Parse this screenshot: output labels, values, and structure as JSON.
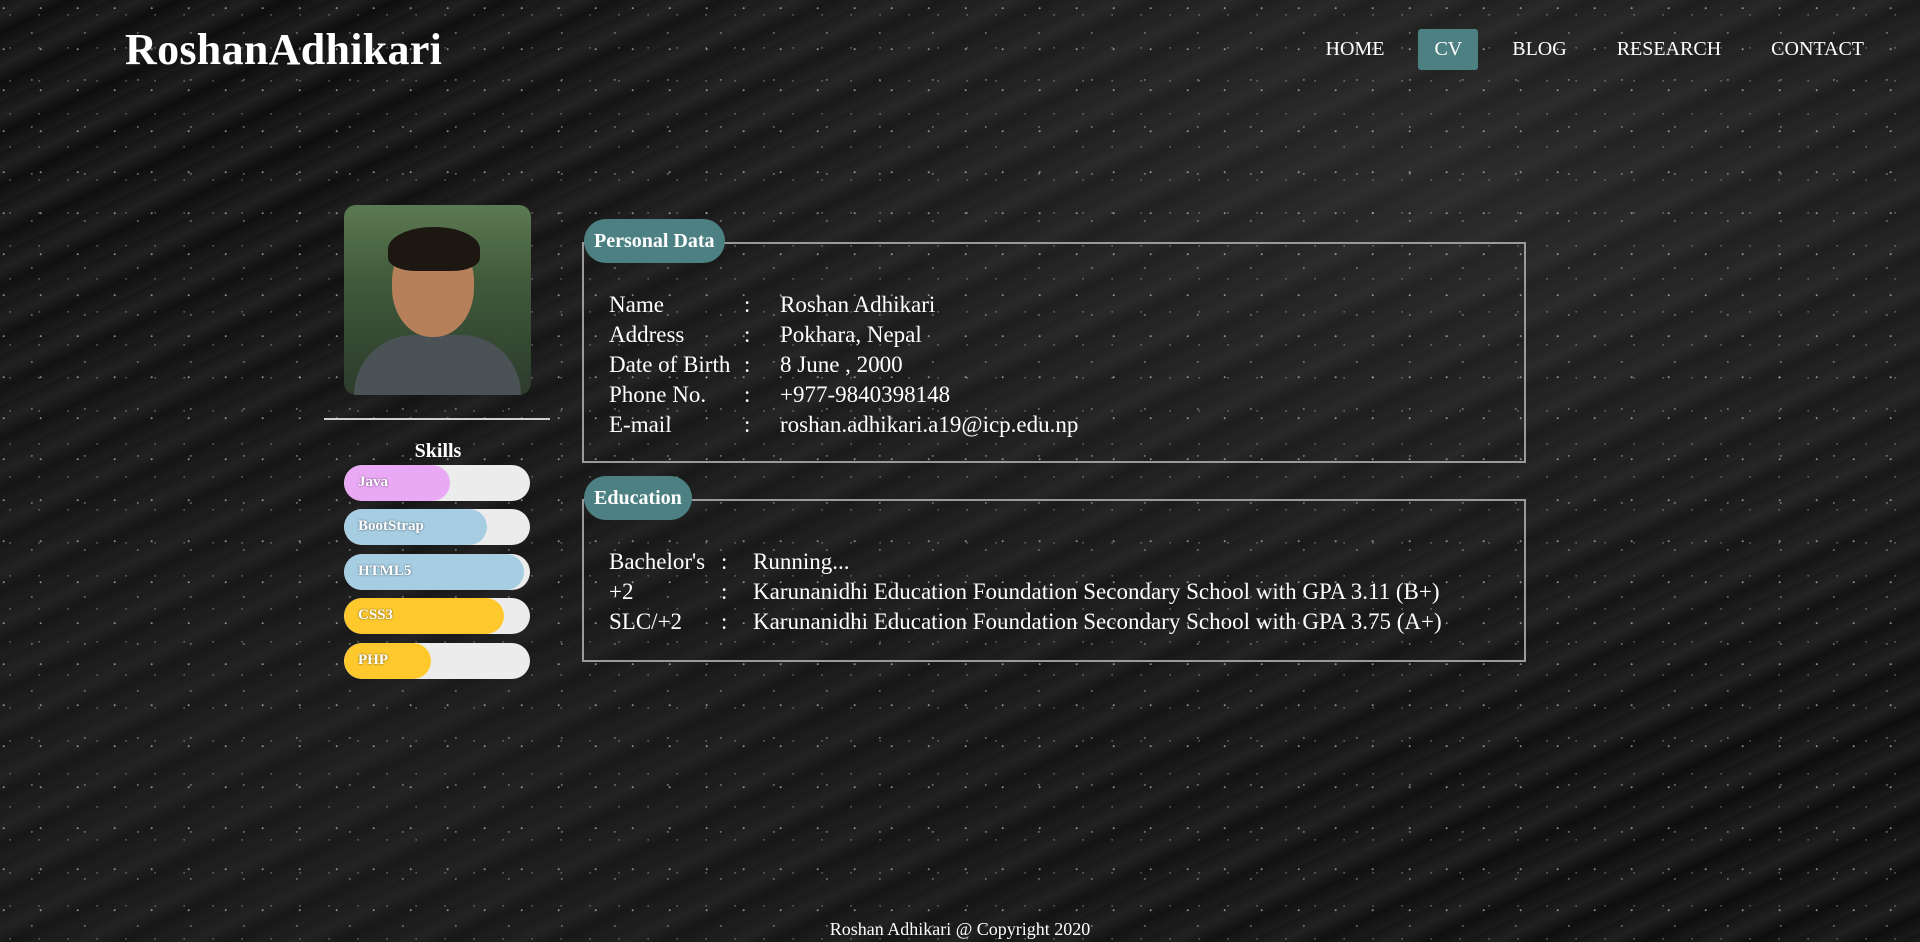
{
  "brand": "RoshanAdhikari",
  "nav": [
    "HOME",
    "CV",
    "BLOG",
    "RESEARCH",
    "CONTACT"
  ],
  "nav_active": "CV",
  "skills": {
    "title": "Skills",
    "items": [
      {
        "name": "Java",
        "level": 0.57,
        "color": "#e9a9f5"
      },
      {
        "name": "BootStrap",
        "level": 0.77,
        "color": "#a6cde2"
      },
      {
        "name": "HTML5",
        "level": 0.97,
        "color": "#a6cde2"
      },
      {
        "name": "CSS3",
        "level": 0.86,
        "color": "#ffc92e"
      },
      {
        "name": "PHP",
        "level": 0.47,
        "color": "#ffc92e"
      }
    ]
  },
  "personal": {
    "title": "Personal Data",
    "rows": [
      {
        "key": "Name",
        "sep": ":",
        "value": "Roshan Adhikari"
      },
      {
        "key": "Address",
        "sep": ":",
        "value": "Pokhara, Nepal"
      },
      {
        "key": "Date of Birth",
        "sep": ":",
        "value": "8 June , 2000"
      },
      {
        "key": "Phone No.",
        "sep": ":",
        "value": "+977-9840398148"
      },
      {
        "key": "E-mail",
        "sep": ":",
        "value": "roshan.adhikari.a19@icp.edu.np"
      }
    ]
  },
  "education": {
    "title": "Education",
    "rows": [
      {
        "key": "Bachelor's",
        "sep": ":",
        "value": "Running..."
      },
      {
        "key": "+2",
        "sep": ":",
        "value": "Karunanidhi Education Foundation Secondary School with GPA 3.11 (B+)"
      },
      {
        "key": "SLC/+2",
        "sep": ":",
        "value": "Karunanidhi Education Foundation Secondary School with GPA 3.75 (A+)"
      }
    ]
  },
  "footer": "Roshan Adhikari @ Copyright 2020"
}
